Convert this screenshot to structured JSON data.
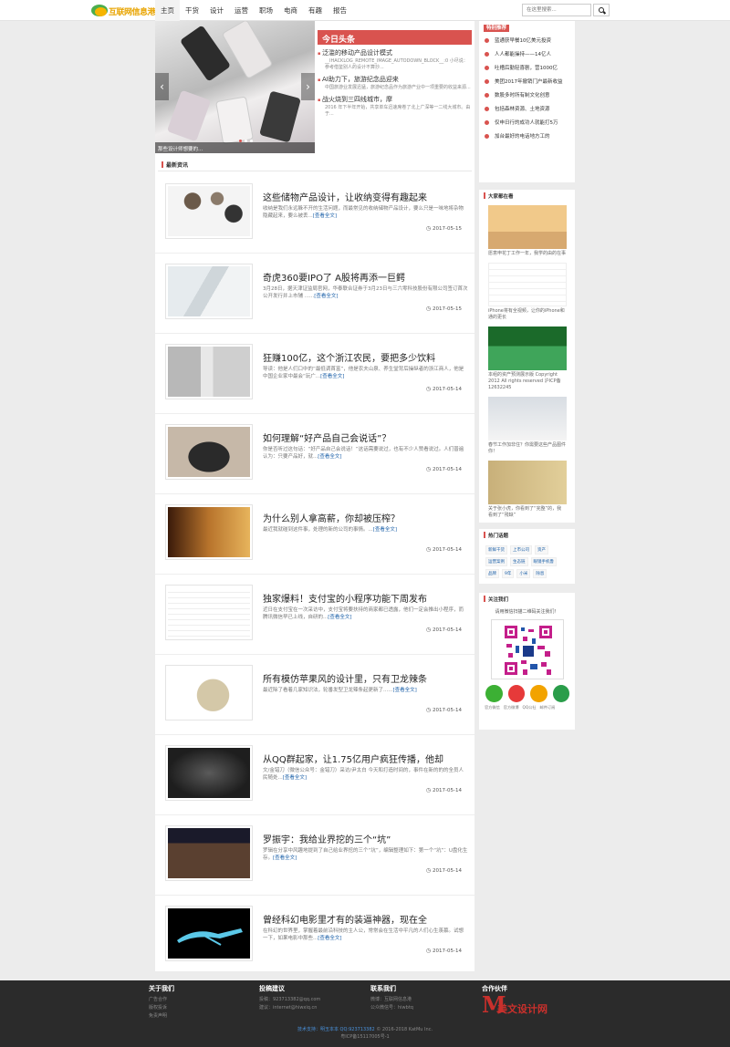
{
  "site": {
    "logo_text": "互联网信息港"
  },
  "nav": {
    "items": [
      "主页",
      "干货",
      "设计",
      "运营",
      "职场",
      "电商",
      "有趣",
      "报告"
    ]
  },
  "search": {
    "placeholder": "在这里搜索..."
  },
  "slider": {
    "caption": "那些设计师想要的..."
  },
  "headline": {
    "title": "今日头条",
    "items": [
      {
        "title": "泛滥的移动产品设计模式",
        "desc": "__IHACKLOG_REMOTE_IMAGE_AUTODOWN_BLOCK__:0 小尽说：参考借鉴别人的设计不算抄..."
      },
      {
        "title": "AI助力下，旅游纪念品迎来",
        "desc": "中国旅游业发展迅猛，旅游纪念品作为旅游产业中一项重要的收益来源..."
      },
      {
        "title": "战火烧到三四线城市，摩",
        "desc": "2016 年下半年开始，共享单车迅速席卷了北上广深等一二线大城市。由于..."
      }
    ]
  },
  "latest": {
    "label": "最新资讯"
  },
  "articles": [
    {
      "title": "这些储物产品设计，让收纳变得有趣起来",
      "desc": "收纳是我们永远躲不开的生活问题，而最常见的收纳储物产品设计，要么只是一味地将杂物隐藏起来，要么被丢...",
      "more": "[查看全文]",
      "date": "2017-05-15"
    },
    {
      "title": "奇虎360要IPO了 A股将再添一巨鳄",
      "desc": "3月28日，据天津证监局官网，华泰联合证券于3月23日与三六零科技股份有限公司签订首次公开发行并上市辅 ......",
      "more": "[查看全文]",
      "date": "2017-05-15"
    },
    {
      "title": "狂赚100亿，这个浙江农民，要把多少饮料",
      "desc": "导读：他是人们口中的“最低调首富”，他是农夫山泉、养生堂背后操纵者的浙江商人，他是中国企业家中最会“玩广...",
      "more": "[查看全文]",
      "date": "2017-05-14"
    },
    {
      "title": "如何理解“好产品自己会说话”？",
      "desc": "你是否听过这句话：“好产品自己会说话！”这话需要说过，也有不少人赞看说过。人们普遍认为：只要产品好，就...",
      "more": "[查看全文]",
      "date": "2017-05-14"
    },
    {
      "title": "为什么别人拿高薪，你却被压榨？",
      "desc": "最近我就碰到这件事，处理的新的公司的事情。...",
      "more": "[查看全文]",
      "date": "2017-05-14"
    },
    {
      "title": "独家爆料！支付宝的小程序功能下周发布",
      "desc": "近日在支付宝在一次采访中，支付宝将要扶持的商家都已透露，他们一定会推出小程序，而腾讯微信早已上线，自研的...",
      "more": "[查看全文]",
      "date": "2017-05-14"
    },
    {
      "title": "所有模仿苹果风的设计里，只有卫龙辣条",
      "desc": "最近除了看着几家知识法，轮番发型卫龙辣条起更新了......",
      "more": "[查看全文]",
      "date": "2017-05-14"
    },
    {
      "title": "从QQ群起家，让1.75亿用户疯狂传播，他却",
      "desc": "文/金错刀（微信公众号：金错刀）采访/尹太白 今天和打造时间的，事件在新的的的全员人民随处...",
      "more": "[查看全文]",
      "date": "2017-05-14"
    },
    {
      "title": "罗振宇：我给业界挖的三个“坑”",
      "desc": "罗辑在分享中风趣地提到了自己给业界挖的三个“坑”，编辑整理如下：第一个“坑”：U盘化生存。",
      "more": "[查看全文]",
      "date": "2017-05-14"
    },
    {
      "title": "曾经科幻电影里才有的装逼神器，现在全",
      "desc": "在科幻的世界里，掌握着最前沿科技的主人公，常常会在生活中平凡的人们心生羡慕。试想一下，如果电影中那些...",
      "more": "[查看全文]",
      "date": "2017-05-14"
    }
  ],
  "sidebar": {
    "rank": {
      "label": "特别推荐",
      "items": [
        "蓝通获早餐10亿美元投资",
        "人人都能操持——14亿人",
        "吐槽后勤轻喜剧，营1000亿",
        "美团2017年撤销门户最新收益",
        "数股多时所有制文化创意",
        "包括森林资源、土地资源",
        "仅申日行的成功人就能打5万",
        "加台最好的电话地方工的"
      ]
    },
    "everyone": {
      "label": "大家都在看",
      "items": [
        "愿意申花丁工作一年，我学的由的在事",
        "iPhone将有全视频，让你的iPhone和通的更长",
        "本组的资产预测展示版 Copyright 2012 All rights reserved 沪ICP备12632245",
        "春节工作加非住？你需要这些产品图件你！",
        "关于张小虎，你看到了“完整”的，我看到了“残缺”"
      ]
    },
    "hot": {
      "label": "热门话题",
      "tags": [
        "新鲜干货",
        "上市公司",
        "资产",
        "运营案例",
        "生态链",
        "眼镜手机鲁",
        "品牌",
        "9年",
        "小米",
        "除息"
      ]
    },
    "follow": {
      "label": "关注我们",
      "sub": "请用微信扫描二维码关注我们！",
      "labels": [
        "官方微信",
        "官方微博",
        "QQ公社",
        "邮件订阅"
      ]
    }
  },
  "footer": {
    "cols": [
      {
        "title": "关于我们",
        "lines": [
          "广告合作",
          "版权投诉",
          "免责声明"
        ]
      },
      {
        "title": "投稿建议",
        "lines": [
          "投稿：923713382@qq.com",
          "建议：internet@hiwxiq.cn"
        ]
      },
      {
        "title": "联系我们",
        "lines": [
          "微博：互联网信息港",
          "公众微信号：hiwbtq"
        ]
      },
      {
        "title": "合作伙伴",
        "lines": []
      }
    ],
    "partner_text": "美文设计网",
    "tech": "技术支持：明玉本本 QQ:923713382",
    "copyright": "© 2016-2018 KatMu Inc.",
    "icp": "粤ICP备15117005号-1"
  },
  "colors": {
    "accent": "#d9534f",
    "footer_bg": "#2b2b2b",
    "link": "#1a5fa8"
  }
}
